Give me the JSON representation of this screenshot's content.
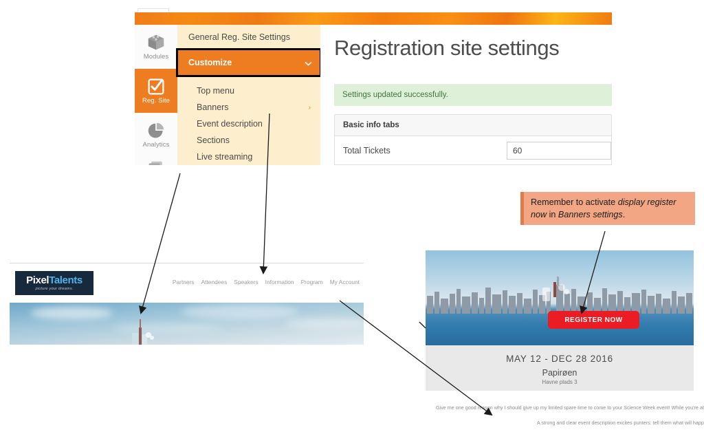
{
  "admin": {
    "sidebar": {
      "items": [
        {
          "label": "Modules",
          "icon": "modules-box-icon",
          "active": false
        },
        {
          "label": "Reg. Site",
          "icon": "checkbox-icon",
          "active": true
        },
        {
          "label": "Analytics",
          "icon": "pie-chart-icon",
          "active": false
        }
      ]
    },
    "flyout": {
      "general_label": "General Reg. Site Settings",
      "customize_label": "Customize",
      "customize_chevron": "chevron-down-icon",
      "sub_items": [
        {
          "label": "Top menu",
          "chevron": ""
        },
        {
          "label": "Banners",
          "chevron": "›"
        },
        {
          "label": "Event description",
          "chevron": ""
        },
        {
          "label": "Sections",
          "chevron": ""
        },
        {
          "label": "Live streaming",
          "chevron": ""
        }
      ]
    },
    "content": {
      "heading": "Registration site settings",
      "alert": "Settings updated successfully.",
      "panel_title": "Basic info tabs",
      "row_label": "Total Tickets",
      "row_value": "60"
    },
    "colors": {
      "accent_orange": "#ED7D20",
      "flyout_bg": "#FDEECD",
      "alert_green": "#DFF0D8"
    }
  },
  "callout": {
    "prefix": "Remember to activate ",
    "emphasis1": "display register now",
    "middle": " in ",
    "emphasis2": "Banners settings",
    "suffix": "."
  },
  "site_left": {
    "logo": {
      "part1": "Pixel",
      "part2": "Talents",
      "tagline": "picture your dreams."
    },
    "nav": [
      "Partners",
      "Attendees",
      "Speakers",
      "Information",
      "Program",
      "My Account"
    ]
  },
  "site_right": {
    "register_button": "REGISTER NOW",
    "dates": "MAY 12 - DEC 28 2016",
    "venue": "Papirøen",
    "address": "Havne plads 3",
    "button_color": "#EC1C24"
  },
  "description": {
    "line1": "Give me one good reason why I should give up my limited spare time to come to your Science Week event! While you're at it, give r",
    "paragraph": "A strong and clear event description excites punters: tell them what will happen at the event, who will be speaking, and what they might g may be brilliant, but no one else will know without you telling and convincing them."
  }
}
